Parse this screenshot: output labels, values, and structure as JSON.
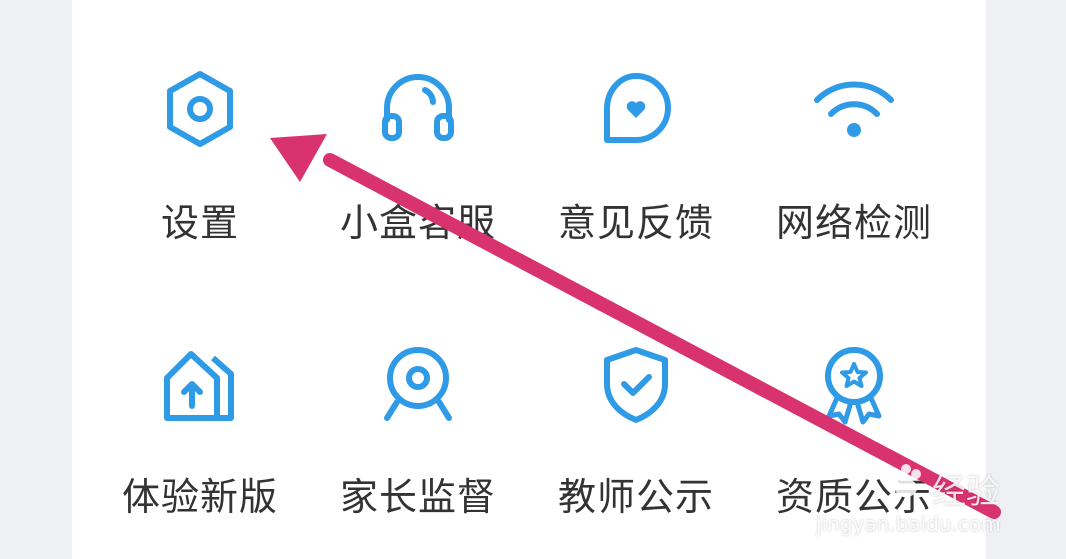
{
  "colors": {
    "icon_blue": "#2f9be6",
    "label_gray": "#333333",
    "arrow_pink": "#d8336f",
    "card_bg": "#ffffff",
    "page_bg": "#eef0f4"
  },
  "grid": {
    "row1": [
      {
        "label": "设置",
        "icon": "settings-hexagon-icon"
      },
      {
        "label": "小盒客服",
        "icon": "headset-icon"
      },
      {
        "label": "意见反馈",
        "icon": "feedback-heart-bubble-icon"
      },
      {
        "label": "网络检测",
        "icon": "wifi-icon"
      }
    ],
    "row2": [
      {
        "label": "体验新版",
        "icon": "new-version-house-icon"
      },
      {
        "label": "家长监督",
        "icon": "webcam-icon"
      },
      {
        "label": "教师公示",
        "icon": "shield-check-icon"
      },
      {
        "label": "资质公示",
        "icon": "award-medal-icon"
      }
    ]
  },
  "watermark": {
    "brand": "经验",
    "url": "jingyan.baidu.com"
  }
}
